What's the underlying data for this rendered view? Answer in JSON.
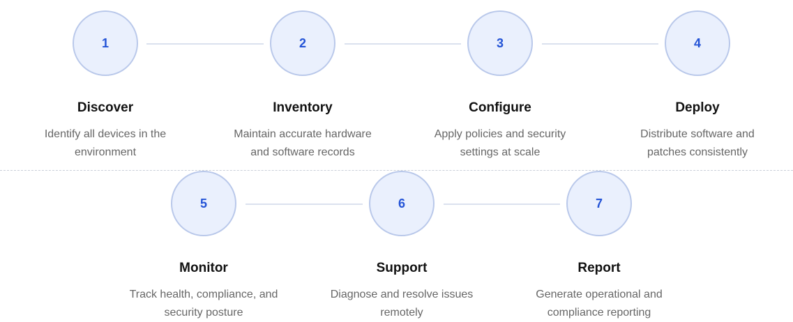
{
  "steps": [
    {
      "number": "1",
      "title": "Discover",
      "desc_line1": "Identify all devices in the",
      "desc_line2": "environment"
    },
    {
      "number": "2",
      "title": "Inventory",
      "desc_line1": "Maintain accurate hardware",
      "desc_line2": "and software records"
    },
    {
      "number": "3",
      "title": "Configure",
      "desc_line1": "Apply policies and security",
      "desc_line2": "settings at scale"
    },
    {
      "number": "4",
      "title": "Deploy",
      "desc_line1": "Distribute software and",
      "desc_line2": "patches consistently"
    },
    {
      "number": "5",
      "title": "Monitor",
      "desc_line1": "Track health, compliance, and",
      "desc_line2": "security posture"
    },
    {
      "number": "6",
      "title": "Support",
      "desc_line1": "Diagnose and resolve issues",
      "desc_line2": "remotely"
    },
    {
      "number": "7",
      "title": "Report",
      "desc_line1": "Generate operational and",
      "desc_line2": "compliance reporting"
    }
  ],
  "colors": {
    "accent": "#2353d6",
    "circle_fill": "#eaf0fd",
    "circle_border": "#b9c8ea",
    "connector": "#dbe1ee"
  }
}
